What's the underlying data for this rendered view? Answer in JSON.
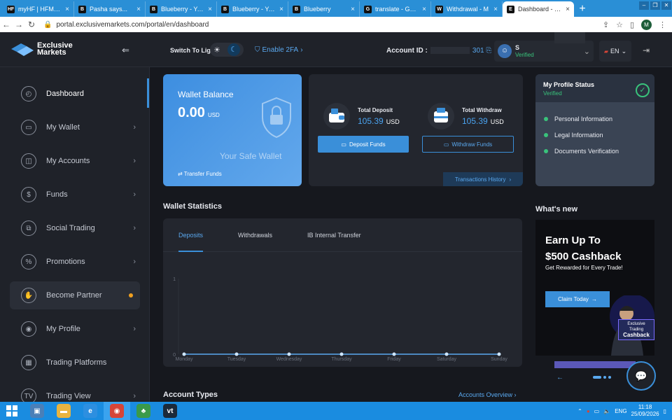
{
  "browser": {
    "tabs": [
      {
        "favicon": "HF",
        "title": "myHF | HFM Bro"
      },
      {
        "favicon": "B",
        "title": "Pasha says..."
      },
      {
        "favicon": "B",
        "title": "Blueberry - Your"
      },
      {
        "favicon": "B",
        "title": "Blueberry - Your"
      },
      {
        "favicon": "B",
        "title": "Blueberry"
      },
      {
        "favicon": "G",
        "title": "translate - Goog"
      },
      {
        "favicon": "W",
        "title": "Withdrawal - M"
      },
      {
        "favicon": "E",
        "title": "Dashboard - Exc"
      }
    ],
    "url": "portal.exclusivemarkets.com/portal/en/dashboard",
    "profile_initial": "M"
  },
  "header": {
    "logo_line1": "Exclusive",
    "logo_line2": "Markets",
    "switch_label": "Switch To Light",
    "twofa": "Enable 2FA",
    "account_label": "Account ID :",
    "account_suffix": "301",
    "user_name": "S",
    "user_status": "Verified",
    "language": "EN"
  },
  "sidebar": {
    "items": [
      {
        "label": "Dashboard",
        "icon": "dashboard-icon",
        "glyph": "◴"
      },
      {
        "label": "My Wallet",
        "icon": "wallet-icon",
        "glyph": "▭"
      },
      {
        "label": "My Accounts",
        "icon": "accounts-icon",
        "glyph": "◫"
      },
      {
        "label": "Funds",
        "icon": "funds-icon",
        "glyph": "$"
      },
      {
        "label": "Social Trading",
        "icon": "social-trading-icon",
        "glyph": "⧉"
      },
      {
        "label": "Promotions",
        "icon": "promotions-icon",
        "glyph": "%"
      },
      {
        "label": "Become Partner",
        "icon": "handshake-icon",
        "glyph": "✋"
      },
      {
        "label": "My Profile",
        "icon": "profile-icon",
        "glyph": "◉"
      },
      {
        "label": "Trading Platforms",
        "icon": "platforms-icon",
        "glyph": "▦"
      },
      {
        "label": "Trading View",
        "icon": "tradingview-icon",
        "glyph": "TV"
      }
    ]
  },
  "wallet": {
    "title": "Wallet Balance",
    "balance": "0.00",
    "currency": "USD",
    "tagline": "Your Safe Wallet",
    "transfer": "Transfer Funds"
  },
  "deposits": {
    "deposit_label": "Total Deposit",
    "deposit_value": "105.39",
    "withdraw_label": "Total Withdraw",
    "withdraw_value": "105.39",
    "currency": "USD",
    "deposit_btn": "Deposit Funds",
    "withdraw_btn": "Withdraw Funds",
    "history": "Transactions History"
  },
  "profile_status": {
    "title": "My Profile Status",
    "status": "Verified",
    "items": [
      "Personal Information",
      "Legal Information",
      "Documents Verification"
    ]
  },
  "wallet_statistics": {
    "title": "Wallet Statistics",
    "tabs": [
      "Deposits",
      "Withdrawals",
      "IB Internal Transfer"
    ]
  },
  "chart_data": {
    "type": "line",
    "categories": [
      "Monday",
      "Tuesday",
      "Wednesday",
      "Thursday",
      "Friday",
      "Saturday",
      "Sunday"
    ],
    "values": [
      0,
      0,
      0,
      0,
      0,
      0,
      0
    ],
    "yticks": [
      "1",
      "0"
    ],
    "ylim": [
      0,
      1
    ],
    "color": "#5aa9f0"
  },
  "whats_new": {
    "title": "What's new",
    "headline_1": "Earn Up To",
    "headline_2": "$500 Cashback",
    "subline": "Get Rewarded for Every Trade!",
    "cta": "Claim Today",
    "badge_1": "Exclusive Trading",
    "badge_2": "Cashback"
  },
  "account_types": {
    "title": "Account Types",
    "overview": "Accounts Overview"
  },
  "taskbar": {
    "apps": [
      {
        "name": "network-app-icon",
        "glyph": "▣",
        "color": "#4a7fb8"
      },
      {
        "name": "file-explorer-icon",
        "glyph": "▬",
        "color": "#e8b440"
      },
      {
        "name": "internet-explorer-icon",
        "glyph": "e",
        "color": "#2d8fe0"
      },
      {
        "name": "chrome-icon",
        "glyph": "◉",
        "color": "#d64537"
      },
      {
        "name": "metatrader-icon",
        "glyph": "♣",
        "color": "#3a9a4a"
      },
      {
        "name": "vt-app-icon",
        "glyph": "vt",
        "color": "#1c2a3a"
      }
    ],
    "lang": "ENG",
    "time": "11:18",
    "date": "25/09/2026"
  }
}
